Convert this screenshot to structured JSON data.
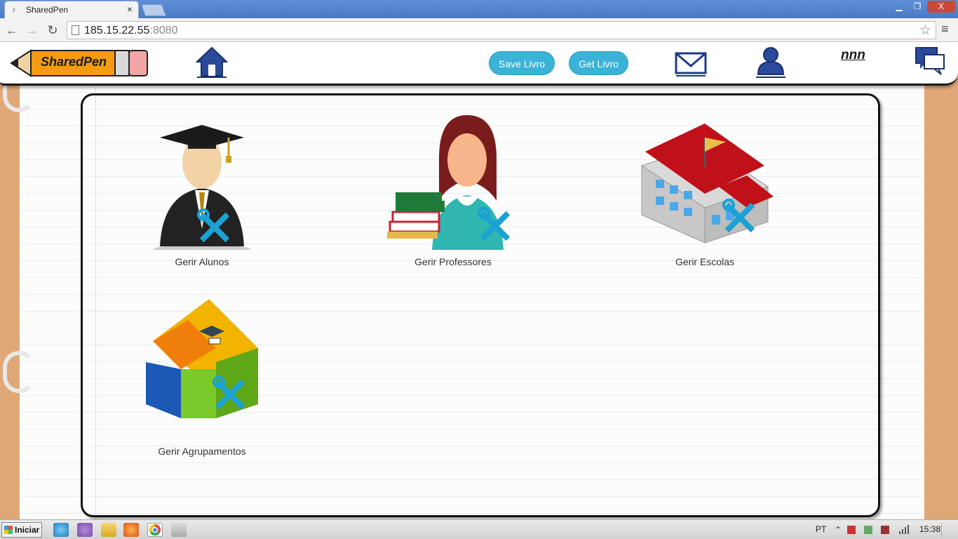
{
  "browser": {
    "tab_title": "SharedPen",
    "tab_close": "×",
    "url_host": "185.15.22.55",
    "url_port": ":8080",
    "window_controls": {
      "minimize": "▁",
      "maximize": "❐",
      "close": "X"
    }
  },
  "header": {
    "logo_text": "SharedPen",
    "save_label": "Save Livro",
    "get_label": "Get Livro",
    "username": "nnn"
  },
  "tiles": [
    {
      "label": "Gerir Alunos",
      "icon": "graduate-student-icon"
    },
    {
      "label": "Gerir Professores",
      "icon": "teacher-icon"
    },
    {
      "label": "Gerir Escolas",
      "icon": "school-building-icon"
    },
    {
      "label": "Gerir Agrupamentos",
      "icon": "puzzle-house-icon"
    }
  ],
  "taskbar": {
    "start_label": "Iniciar",
    "language": "PT",
    "clock": "15:38"
  },
  "colors": {
    "accent_button": "#3ab3d6",
    "page_background": "#e0a777",
    "icon_blue": "#1e3a8a",
    "tool_blue": "#1ba1d4"
  }
}
